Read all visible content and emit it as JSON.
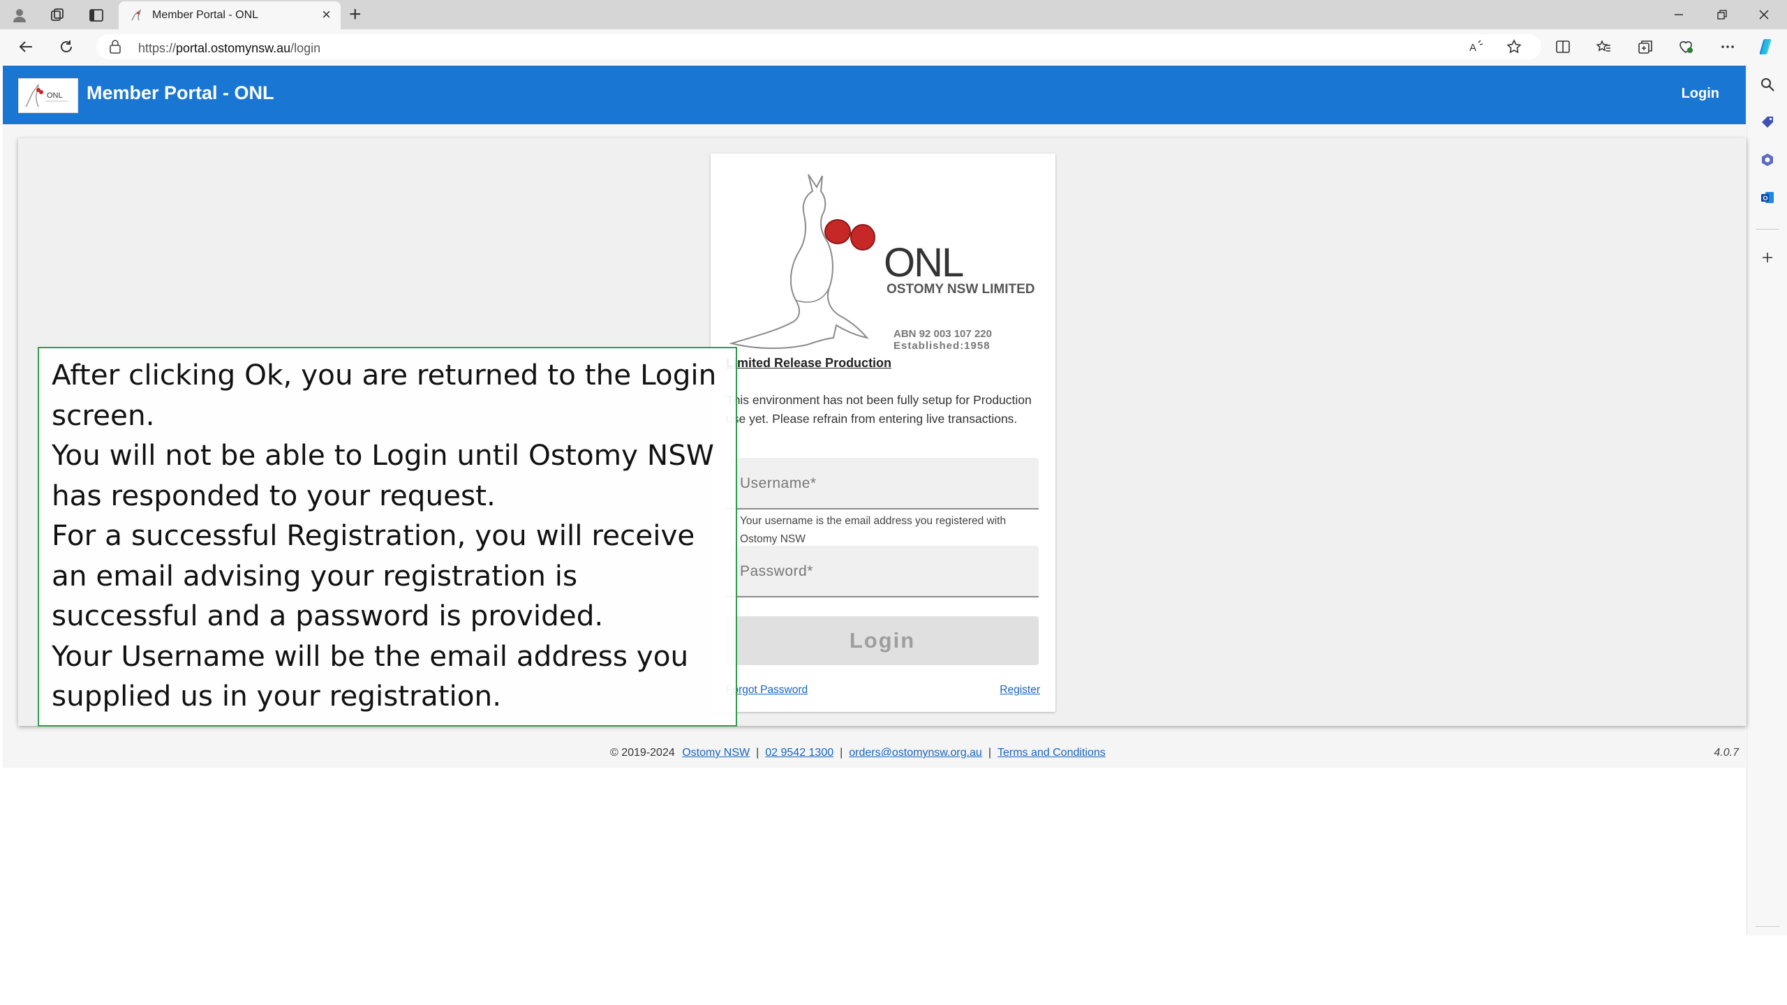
{
  "browser": {
    "tab_title": "Member Portal - ONL",
    "url_prefix": "https://",
    "url_host": "portal.ostomynsw.au",
    "url_path": "/login"
  },
  "header": {
    "title": "Member Portal - ONL",
    "login_label": "Login",
    "accent_color": "#1976d2"
  },
  "brand": {
    "name": "ONL",
    "full_name": "OSTOMY NSW LIMITED",
    "abn": "ABN 92 003 107 220",
    "established": "Established:1958"
  },
  "login_card": {
    "notice_title": "Limited Release Production",
    "notice_body": "This environment has not been fully setup for Production use yet.  Please refrain from entering live transactions.",
    "username_placeholder": "Username*",
    "username_hint": "Your username is the email address you registered with Ostomy NSW",
    "password_placeholder": "Password*",
    "login_button": "Login",
    "forgot_password": "Forgot Password",
    "register": "Register"
  },
  "footer": {
    "copyright": "© 2019-2024",
    "org_link": "Ostomy NSW",
    "phone": "02 9542 1300",
    "email": "orders@ostomynsw.org.au",
    "terms": "Terms and Conditions",
    "separator": "|",
    "version": "4.0.7"
  },
  "annotation": {
    "lines": [
      "After clicking Ok, you are returned to the Login screen.",
      "You will not be able to Login until Ostomy NSW has responded to your request.",
      "For a successful Registration, you will receive an email advising your registration is successful and a password is provided.",
      "Your Username will be the email address you supplied us in your registration."
    ],
    "border_color": "#2e9e4b"
  },
  "icons": {
    "tabbar": [
      "profile-icon",
      "workspaces-icon",
      "tab-actions-icon"
    ],
    "toolbar": [
      "back-icon",
      "refresh-icon",
      "lock-icon",
      "read-aloud-icon",
      "favorite-star-icon",
      "split-screen-icon",
      "favorites-icon",
      "collections-icon",
      "browser-essentials-icon",
      "more-icon",
      "copilot-icon"
    ],
    "sidebar": [
      "search-icon",
      "shopping-icon",
      "office-icon",
      "outlook-icon",
      "add-icon"
    ]
  }
}
